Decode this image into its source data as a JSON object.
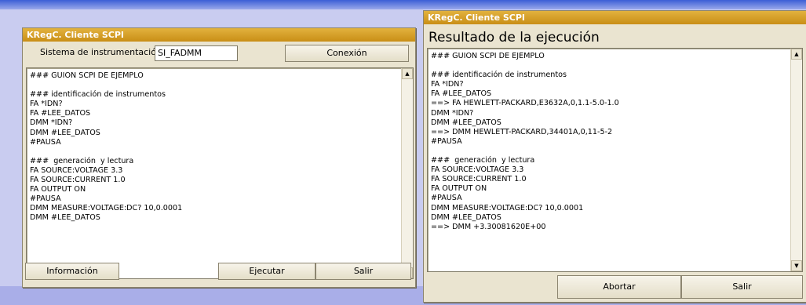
{
  "left_window": {
    "title": "KRegC. Cliente SCPI",
    "system_label": "Sistema de instrumentación",
    "system_value": "SI_FADMM",
    "connect_label": "Conexión",
    "script_lines": [
      "### GUION SCPI DE EJEMPLO",
      "",
      "### identificación de instrumentos",
      "FA *IDN?",
      "FA #LEE_DATOS",
      "DMM *IDN?",
      "DMM #LEE_DATOS",
      "#PAUSA",
      "",
      "###  generación  y lectura",
      "FA SOURCE:VOLTAGE 3.3",
      "FA SOURCE:CURRENT 1.0",
      "FA OUTPUT ON",
      "#PAUSA",
      "DMM MEASURE:VOLTAGE:DC? 10,0.0001",
      "DMM #LEE_DATOS"
    ],
    "info_label": "Información",
    "run_label": "Ejecutar",
    "exit_label": "Salir"
  },
  "right_window": {
    "title": "KRegC. Cliente SCPI",
    "heading": "Resultado de la ejecución",
    "output_lines": [
      "### GUION SCPI DE EJEMPLO",
      "",
      "### identificación de instrumentos",
      "FA *IDN?",
      "FA #LEE_DATOS",
      "==> FA HEWLETT-PACKARD,E3632A,0,1.1-5.0-1.0",
      "DMM *IDN?",
      "DMM #LEE_DATOS",
      "==> DMM HEWLETT-PACKARD,34401A,0,11-5-2",
      "#PAUSA",
      "",
      "###  generación  y lectura",
      "FA SOURCE:VOLTAGE 3.3",
      "FA SOURCE:CURRENT 1.0",
      "FA OUTPUT ON",
      "#PAUSA",
      "DMM MEASURE:VOLTAGE:DC? 10,0.0001",
      "DMM #LEE_DATOS",
      "==> DMM +3.30081620E+00"
    ],
    "abort_label": "Abortar",
    "exit_label": "Salir"
  },
  "icons": {
    "scroll_up": "▲",
    "scroll_down": "▼"
  }
}
